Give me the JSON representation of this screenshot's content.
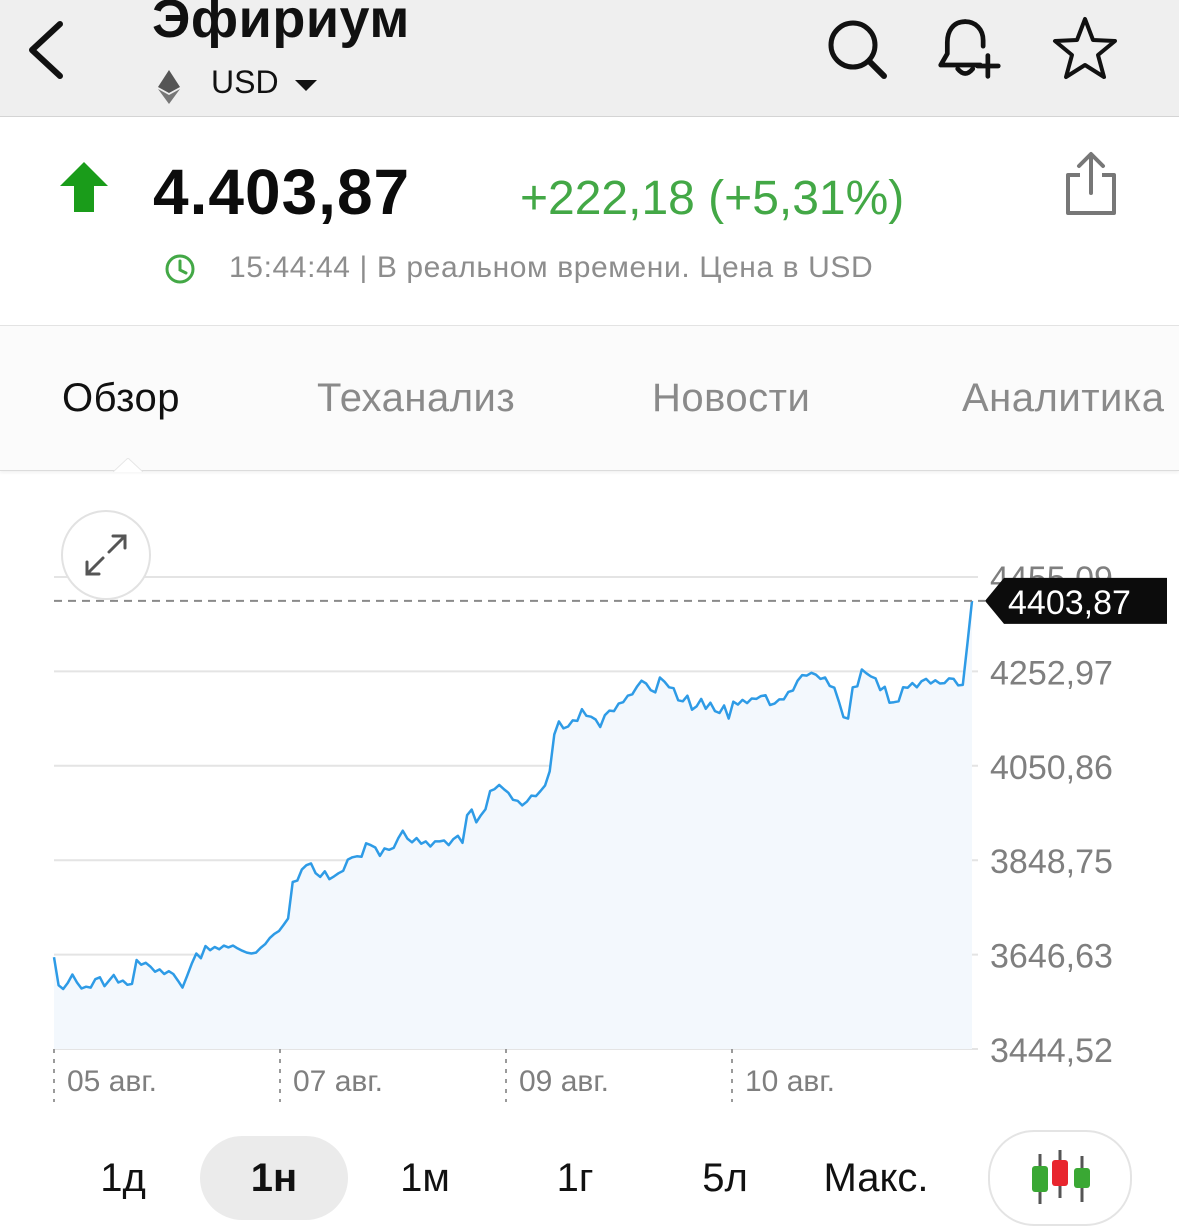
{
  "header": {
    "title": "Эфириум",
    "currency": "USD",
    "icons": [
      "back-icon",
      "ethereum-icon",
      "chevron-down-icon",
      "search-icon",
      "bell-plus-icon",
      "star-icon"
    ]
  },
  "quote": {
    "price": "4.403,87",
    "change": "+222,18 (+5,31%)",
    "time": "15:44:44",
    "status": "| В реальном времени. Цена в USD",
    "direction": "up",
    "up_color": "#1a9c1a",
    "change_color": "#43a846"
  },
  "tabs": [
    {
      "label": "Обзор",
      "active": true
    },
    {
      "label": "Теханализ",
      "active": false
    },
    {
      "label": "Новости",
      "active": false
    },
    {
      "label": "Аналитика",
      "active": false
    }
  ],
  "chart_data": {
    "type": "area",
    "ylim": [
      3444.52,
      4455.09
    ],
    "y_ticks": [
      "4455,09",
      "4252,97",
      "4050,86",
      "3848,75",
      "3646,63",
      "3444,52"
    ],
    "x_ticks": [
      "05 авг.",
      "07 авг.",
      "09 авг.",
      "10 авг."
    ],
    "current_label": "4403,87",
    "current_value": 4403.87,
    "line_color": "#2e9be6",
    "series": [
      {
        "values": [
          3641,
          3581,
          3573,
          3586,
          3604,
          3587,
          3574,
          3578,
          3576,
          3594,
          3598,
          3579,
          3591,
          3603,
          3587,
          3591,
          3582,
          3584,
          3635,
          3625,
          3629,
          3621,
          3610,
          3615,
          3605,
          3611,
          3605,
          3591,
          3576,
          3601,
          3627,
          3649,
          3639,
          3665,
          3656,
          3663,
          3658,
          3666,
          3662,
          3666,
          3660,
          3655,
          3651,
          3649,
          3651,
          3661,
          3669,
          3682,
          3691,
          3697,
          3710,
          3724,
          3802,
          3805,
          3829,
          3838,
          3842,
          3821,
          3813,
          3825,
          3808,
          3814,
          3821,
          3826,
          3850,
          3855,
          3857,
          3856,
          3885,
          3881,
          3876,
          3858,
          3874,
          3871,
          3875,
          3896,
          3912,
          3895,
          3887,
          3896,
          3884,
          3889,
          3878,
          3889,
          3889,
          3891,
          3881,
          3894,
          3901,
          3886,
          3945,
          3957,
          3930,
          3945,
          3958,
          3997,
          4001,
          4010,
          4001,
          3993,
          3978,
          3976,
          3966,
          3974,
          3987,
          3986,
          3997,
          4009,
          4039,
          4118,
          4146,
          4131,
          4135,
          4148,
          4147,
          4172,
          4158,
          4156,
          4150,
          4134,
          4159,
          4169,
          4168,
          4184,
          4187,
          4201,
          4204,
          4220,
          4233,
          4227,
          4213,
          4208,
          4240,
          4231,
          4219,
          4217,
          4191,
          4189,
          4201,
          4171,
          4178,
          4194,
          4173,
          4186,
          4168,
          4164,
          4180,
          4152,
          4188,
          4182,
          4192,
          4185,
          4195,
          4194,
          4200,
          4202,
          4181,
          4184,
          4193,
          4193,
          4209,
          4212,
          4233,
          4245,
          4244,
          4250,
          4246,
          4237,
          4240,
          4222,
          4218,
          4188,
          4155,
          4152,
          4219,
          4221,
          4257,
          4249,
          4242,
          4238,
          4213,
          4220,
          4186,
          4187,
          4189,
          4219,
          4218,
          4228,
          4219,
          4232,
          4237,
          4227,
          4234,
          4227,
          4228,
          4238,
          4237,
          4223,
          4224,
          4312,
          4404
        ]
      }
    ]
  },
  "periods": [
    {
      "label": "1д",
      "active": false
    },
    {
      "label": "1н",
      "active": true
    },
    {
      "label": "1м",
      "active": false
    },
    {
      "label": "1г",
      "active": false
    },
    {
      "label": "5л",
      "active": false
    },
    {
      "label": "Макс.",
      "active": false
    }
  ],
  "candle_colors": {
    "green": "#3aa834",
    "red": "#e8262e"
  }
}
